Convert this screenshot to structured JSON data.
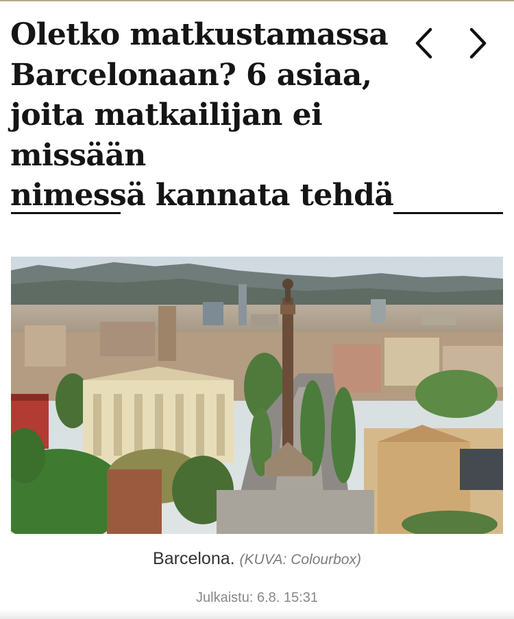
{
  "article": {
    "headline_lines": [
      "Oletko matkustamassa",
      "Barcelonaan? 6 asiaa,",
      "joita matkailijan ei missään",
      "nimessä kannata tehdä"
    ],
    "caption": "Barcelona.",
    "credit": "(KUVA: Colourbox)",
    "published": "Julkaistu: 6.8. 15:31"
  },
  "nav": {
    "prev_icon": "chevron-left-icon",
    "next_icon": "chevron-right-icon"
  },
  "colors": {
    "top_rule": "#b7ab8c",
    "headline": "#151515",
    "caption": "#333333",
    "credit": "#7c7c7c",
    "published": "#888888"
  }
}
